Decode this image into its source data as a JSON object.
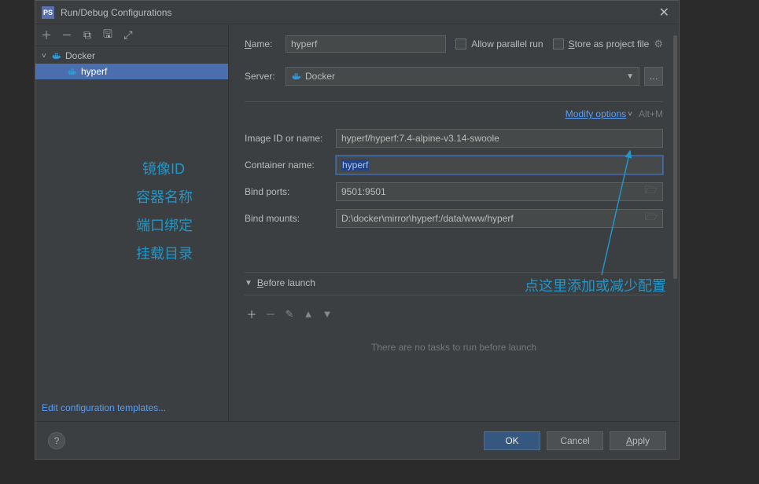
{
  "title": "Run/Debug Configurations",
  "tree": {
    "parent": "Docker",
    "child": "hyperf"
  },
  "editTemplates": "Edit configuration templates...",
  "nameLabel": "Name:",
  "nameValue": "hyperf",
  "allowParallel": "Allow parallel run",
  "storeAsProject": "Store as project file",
  "serverLabel": "Server:",
  "serverValue": "Docker",
  "modifyOptions": "Modify options",
  "modifyShortcut": "Alt+M",
  "fields": {
    "imageId": {
      "label": "Image ID or name:",
      "value": "hyperf/hyperf:7.4-alpine-v3.14-swoole"
    },
    "containerName": {
      "label": "Container name:",
      "value": "hyperf"
    },
    "bindPorts": {
      "label": "Bind ports:",
      "value": "9501:9501"
    },
    "bindMounts": {
      "label": "Bind mounts:",
      "value": "D:\\docker\\mirror\\hyperf:/data/www/hyperf"
    }
  },
  "beforeLaunch": {
    "title": "Before launch",
    "empty": "There are no tasks to run before launch"
  },
  "buttons": {
    "ok": "OK",
    "cancel": "Cancel",
    "apply": "Apply"
  },
  "annotations": {
    "imageId": "镜像ID",
    "containerName": "容器名称",
    "bindPorts": "端口绑定",
    "bindMounts": "挂载目录",
    "tip": "点这里添加或减少配置"
  }
}
